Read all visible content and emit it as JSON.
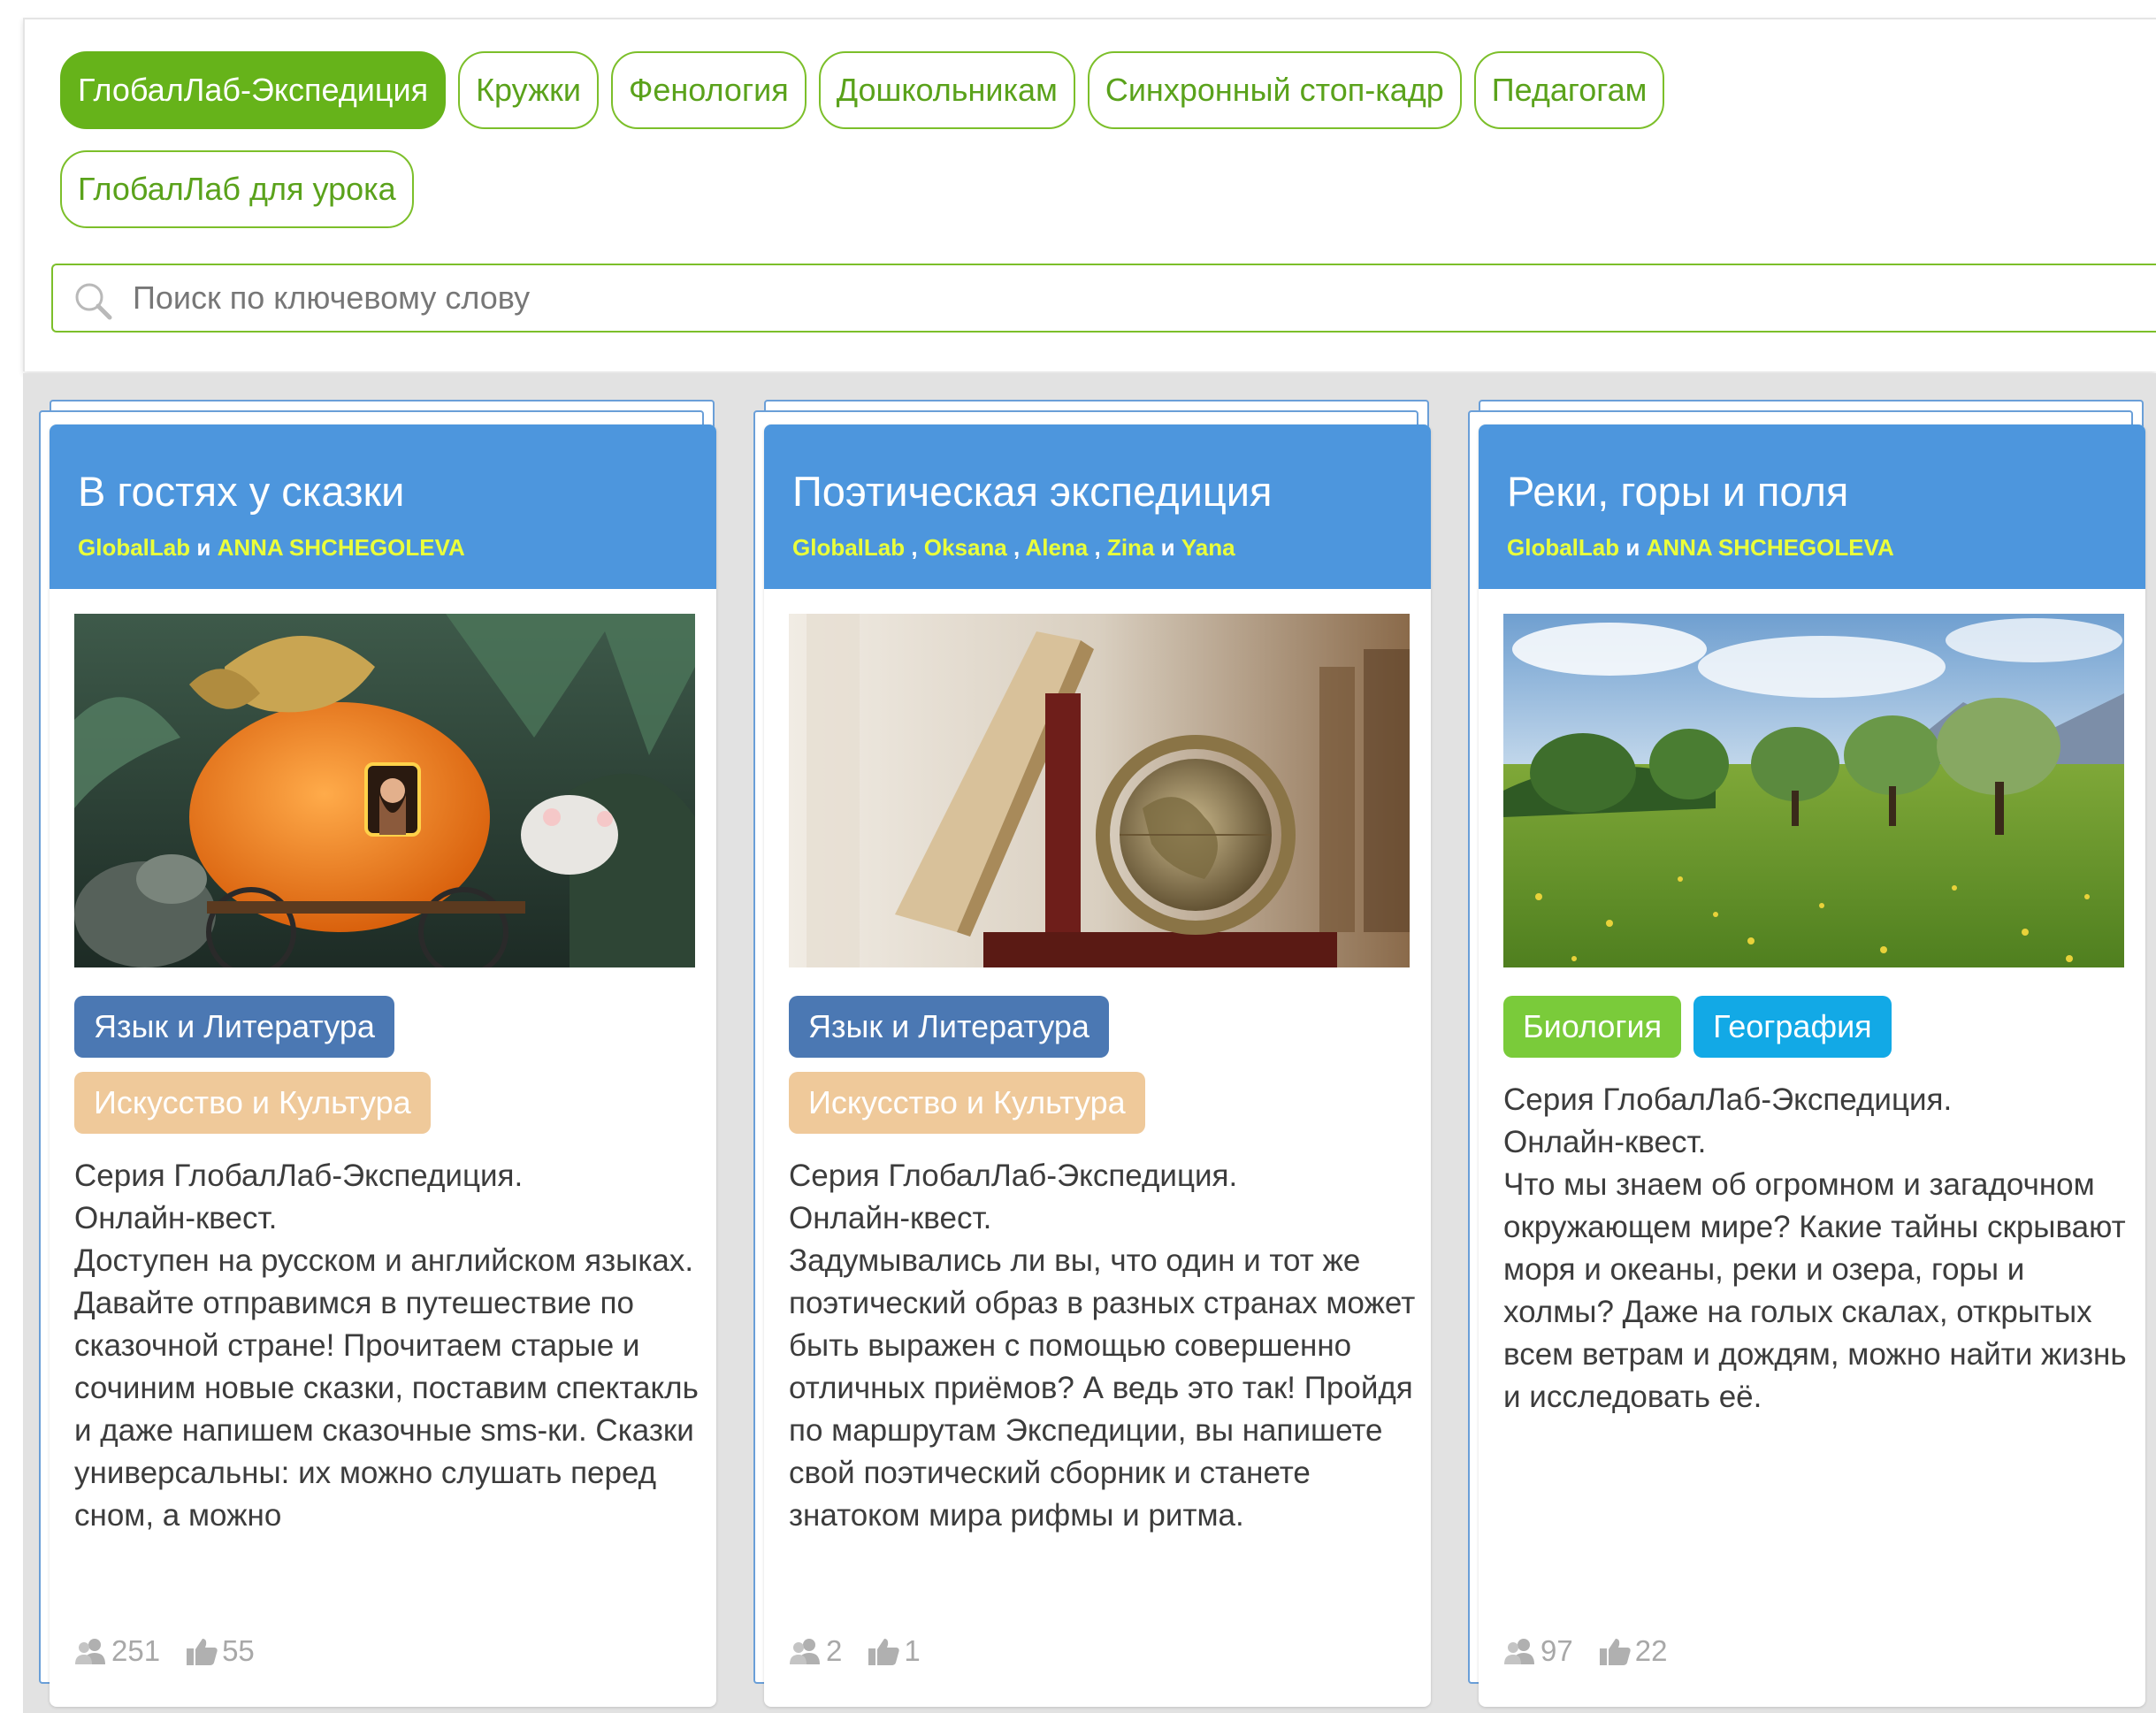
{
  "filters": {
    "row1": [
      {
        "label": "ГлобалЛаб-Экспедиция",
        "active": true
      },
      {
        "label": "Кружки",
        "active": false
      },
      {
        "label": "Фенология",
        "active": false
      },
      {
        "label": "Дошкольникам",
        "active": false
      },
      {
        "label": "Синхронный стоп-кадр",
        "active": false
      },
      {
        "label": "Педагогам",
        "active": false
      }
    ],
    "row2": [
      {
        "label": "ГлобалЛаб для урока",
        "active": false
      }
    ]
  },
  "search": {
    "placeholder": "Поиск по ключевому слову",
    "icon": "search-icon"
  },
  "colors": {
    "accent_green": "#66b31a",
    "header_blue": "#4d96dd",
    "author_yellow": "#eaff3a",
    "tag_language": "#4b78b3",
    "tag_art": "#efc99a",
    "tag_biology": "#7acb3a",
    "tag_geography": "#12a9e6"
  },
  "cards": [
    {
      "title": "В гостях у сказки",
      "authors": [
        "GlobalLab",
        "ANNA SHCHEGOLEVA"
      ],
      "sep": [
        " и "
      ],
      "image": "pumpkin-carriage-photo",
      "tags": [
        [
          "Язык и Литература"
        ],
        [
          "Искусство и Культура"
        ]
      ],
      "description": [
        "Серия ГлобалЛаб-Экспедиция.",
        "Онлайн-квест.",
        "Доступен на русском и английском языках.",
        "Давайте отправимся в путешествие по сказочной стране! Прочитаем старые и сочиним новые сказки, поставим спектакль и даже напишем сказочные sms-ки. Сказки универсальны: их можно слушать перед сном, а можно"
      ],
      "participants": "251",
      "likes": "55"
    },
    {
      "title": "Поэтическая экспедиция",
      "authors": [
        "GlobalLab",
        "Oksana",
        "Alena",
        "Zina",
        "Yana"
      ],
      "sep": [
        " , ",
        " , ",
        " , ",
        " и "
      ],
      "image": "book-and-globe-photo",
      "tags": [
        [
          "Язык и Литература"
        ],
        [
          "Искусство и Культура"
        ]
      ],
      "description": [
        "Серия ГлобалЛаб-Экспедиция.",
        "Онлайн-квест.",
        "Задумывались ли вы, что один и тот же поэтический образ в разных странах может быть выражен с помощью совершенно отличных приёмов? А ведь это так! Пройдя по маршрутам Экспедиции, вы напишете свой поэтический сборник и станете знатоком мира рифмы и ритма."
      ],
      "participants": "2",
      "likes": "1"
    },
    {
      "title": "Реки, горы и поля",
      "authors": [
        "GlobalLab",
        "ANNA SHCHEGOLEVA"
      ],
      "sep": [
        " и "
      ],
      "image": "meadow-landscape-photo",
      "tags": [
        [
          "Биология",
          "География"
        ]
      ],
      "description": [
        "Серия ГлобалЛаб-Экспедиция.",
        "Онлайн-квест.",
        "Что мы знаем об огромном и загадочном окружающем мире? Какие тайны скрывают моря и океаны, реки и озера, горы и холмы? Даже на голых скалах, открытых всем ветрам и дождям, можно найти жизнь и исследовать её."
      ],
      "participants": "97",
      "likes": "22"
    }
  ]
}
